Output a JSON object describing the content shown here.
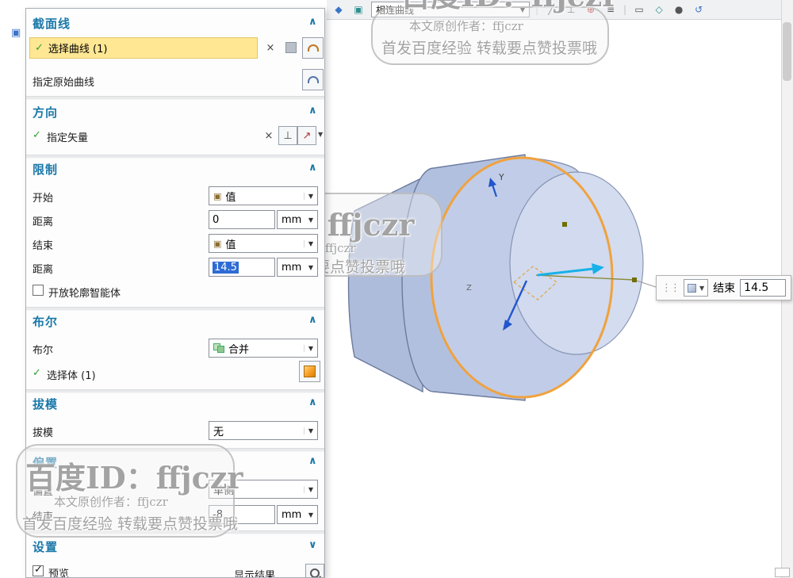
{
  "colors": {
    "accent_blue": "#1a78a8",
    "highlight_yellow": "#ffe794",
    "selection_blue": "#2e6bd4",
    "model_fill": "#b7c3e1",
    "model_edge": "#6b7a9e",
    "section_orange": "#f0a23e"
  },
  "icons": {
    "collapse": "∧",
    "expand": "∨",
    "check": "✓",
    "reset": "×",
    "dropdown": "▼",
    "small_dropdown": "▾",
    "value_prefix": "▣",
    "vector_up": "↗",
    "vector_alt": "⊥",
    "handle": "⋮⋮",
    "panel_mini": "▣"
  },
  "toolbar": {
    "combo_value": "相连曲线",
    "icon_glyphs": [
      "◆",
      "▣",
      "╱",
      "⊥",
      "⊕",
      "≡",
      "▭",
      "◇",
      "●",
      "↺"
    ]
  },
  "dialog": {
    "section_line": {
      "title": "截面线",
      "select_curve": "选择曲线 (1)",
      "origin_curve": "指定原始曲线"
    },
    "direction": {
      "title": "方向",
      "specify_vector": "指定矢量"
    },
    "limits": {
      "title": "限制",
      "start_label": "开始",
      "start_mode": "值",
      "start_dist_label": "距离",
      "start_dist": "0",
      "end_label": "结束",
      "end_mode": "值",
      "end_dist_label": "距离",
      "end_dist": "14.5",
      "unit": "mm",
      "open_profile": "开放轮廓智能体"
    },
    "boolean": {
      "title": "布尔",
      "label": "布尔",
      "value": "合并",
      "select_body": "选择体 (1)"
    },
    "draft": {
      "title": "拔模",
      "label": "拔模",
      "value": "无"
    },
    "offset": {
      "title": "偏置",
      "label": "偏置",
      "mode": "单侧",
      "end_label": "结束",
      "end_value": "-8",
      "unit": "mm"
    },
    "settings": {
      "title": "设置",
      "preview": "预览",
      "show_result": "显示结果"
    }
  },
  "viewport": {
    "floating_label": "结束",
    "floating_value": "14.5",
    "axis_y": "Y",
    "axis_z": "Z"
  },
  "watermarks": {
    "top_big": "百度ID：ffjczr",
    "top_author": "本文原创作者：ffjczr",
    "top_slogan": "首发百度经验 转载要点赞投票哦",
    "mid_big": "百度ID：ffjczr",
    "mid_author": "本文原创作者: ffjczr",
    "mid_slogan": "发百度经验 转载要点赞投票哦",
    "bottom_big": "百度ID：ffjczr",
    "bottom_author": "本文原创作者：ffjczr",
    "bottom_slogan": "首发百度经验 转载要点赞投票哦"
  }
}
